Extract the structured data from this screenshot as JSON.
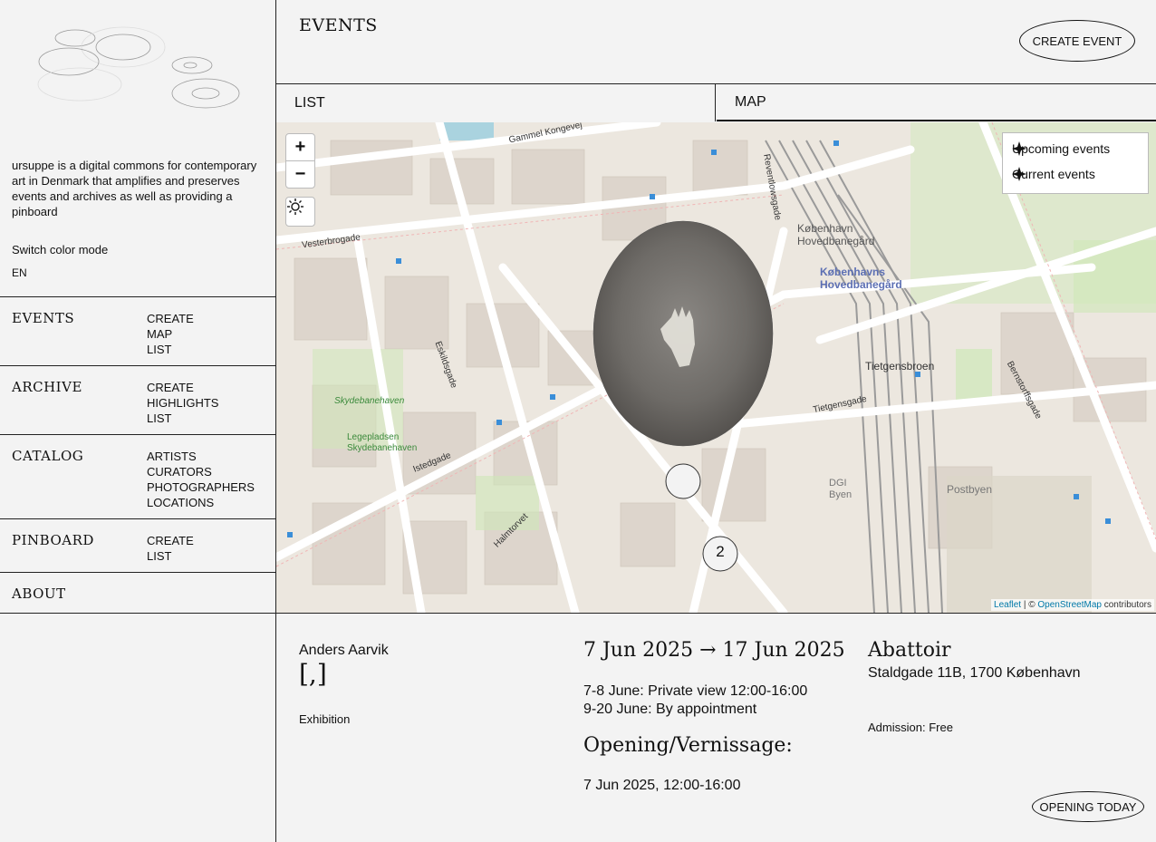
{
  "sidebar": {
    "intro": "ursuppe is a digital commons for contemporary art in Denmark that amplifies and preserves events and archives as well as providing a pinboard",
    "switch_color": "Switch color mode",
    "language": "EN",
    "sections": [
      {
        "title": "EVENTS",
        "links": [
          "CREATE",
          "MAP",
          "LIST"
        ]
      },
      {
        "title": "ARCHIVE",
        "links": [
          "CREATE",
          "HIGHLIGHTS",
          "LIST"
        ]
      },
      {
        "title": "CATALOG",
        "links": [
          "ARTISTS",
          "CURATORS",
          "PHOTOGRAPHERS",
          "LOCATIONS"
        ]
      },
      {
        "title": "PINBOARD",
        "links": [
          "CREATE",
          "LIST"
        ]
      },
      {
        "title": "ABOUT",
        "links": []
      }
    ]
  },
  "header": {
    "title": "EVENTS",
    "create_button": "CREATE EVENT"
  },
  "tabs": {
    "list": "LIST",
    "map": "MAP"
  },
  "map": {
    "zoom_in": "+",
    "zoom_out": "−",
    "legend": [
      "Upcoming events",
      "Current events"
    ],
    "cluster_count": "2",
    "labels": {
      "vesterbrogade": "Vesterbrogade",
      "hovedbanegard1": "København",
      "hovedbanegard2": "Hovedbanegård",
      "hovedbanegard3": "Københavns",
      "tietgensbroen": "Tietgensbroen",
      "dgi": "DGI",
      "byen": "Byen",
      "postbyen": "Postbyen",
      "skydebanehaven": "Skydebanehaven",
      "legepladsen": "Legepladsen",
      "istedgade": "Istedgade",
      "halmtorvet": "Halmtorvet",
      "bernstorffsgade": "Bernstorffsgade",
      "tietgensgade": "Tietgensgade",
      "eskildsgade": "Eskildsgade",
      "reventlowsgade": "Reventlowsgade",
      "gammel_kongevej": "Gammel Kongevej"
    },
    "attribution": {
      "leaflet": "Leaflet",
      "sep": " | © ",
      "osm": "OpenStreetMap",
      "suffix": " contributors"
    }
  },
  "event": {
    "artist": "Anders Aarvik",
    "title": "[,]",
    "type": "Exhibition",
    "dates": "7 Jun 2025 → 17 Jun 2025",
    "schedule": [
      "7-8 June: Private view 12:00-16:00",
      "9-20 June: By appointment"
    ],
    "opening_heading": "Opening/Vernissage:",
    "opening_time": "7 Jun 2025, 12:00-16:00",
    "venue": "Abattoir",
    "address": "Staldgade 11B, 1700 København",
    "admission": "Admission: Free",
    "opening_today": "OPENING TODAY"
  },
  "colors": {
    "park": "#cfe8b8",
    "road": "#ffffff",
    "rail": "#9a9a9a",
    "building": "#d8d0c8",
    "label_blue": "#5c6fb3"
  }
}
